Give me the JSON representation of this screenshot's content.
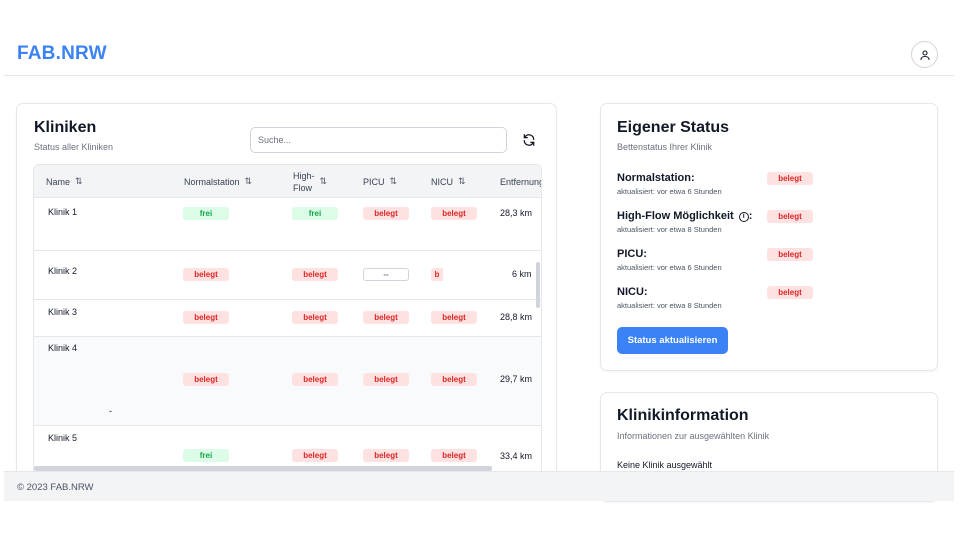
{
  "app": {
    "brand": "FAB.NRW"
  },
  "kliniken": {
    "title": "Kliniken",
    "subtitle": "Status aller Kliniken",
    "search_placeholder": "Suche...",
    "columns": {
      "name": "Name",
      "normal": "Normalstation",
      "highflow_1": "High-",
      "highflow_2": "Flow",
      "picu": "PICU",
      "nicu": "NICU",
      "distance": "Entfernung"
    },
    "rows": [
      {
        "name": "Klinik 1",
        "normal": "frei",
        "highflow": "frei",
        "picu": "belegt",
        "nicu": "belegt",
        "distance": "28,3 km"
      },
      {
        "name": "Klinik 2",
        "normal": "belegt",
        "highflow": "belegt",
        "picu": "--",
        "nicu": "b",
        "distance": "6 km"
      },
      {
        "name": "Klinik 3",
        "normal": "belegt",
        "highflow": "belegt",
        "picu": "belegt",
        "nicu": "belegt",
        "distance": "28,8 km"
      },
      {
        "name": "Klinik 4",
        "normal": "belegt",
        "highflow": "belegt",
        "picu": "belegt",
        "nicu": "belegt",
        "distance": "29,7 km",
        "extra": "-"
      },
      {
        "name": "Klinik 5",
        "normal": "frei",
        "highflow": "belegt",
        "picu": "belegt",
        "nicu": "belegt",
        "distance": "33,4 km"
      }
    ]
  },
  "status": {
    "title": "Eigener Status",
    "subtitle": "Bettenstatus Ihrer Klinik",
    "items": [
      {
        "label": "Normalstation:",
        "updated": "aktualisiert: vor etwa 6 Stunden",
        "value": "belegt"
      },
      {
        "label": "High-Flow Möglichkeit",
        "suffix": ":",
        "updated": "aktualisiert: vor etwa 8 Stunden",
        "value": "belegt"
      },
      {
        "label": "PICU:",
        "updated": "aktualisiert: vor etwa 6 Stunden",
        "value": "belegt"
      },
      {
        "label": "NICU:",
        "updated": "aktualisiert: vor etwa 8 Stunden",
        "value": "belegt"
      }
    ],
    "button": "Status aktualisieren"
  },
  "klinikinfo": {
    "title": "Klinikinformation",
    "subtitle": "Informationen zur ausgewählten Klinik",
    "empty": "Keine Klinik ausgewählt"
  },
  "footer": {
    "text": "© 2023 FAB.NRW"
  },
  "colors": {
    "accent": "#3b82f6",
    "frei_bg": "#dcfce7",
    "frei_fg": "#16a34a",
    "belegt_bg": "#fee2e2",
    "belegt_fg": "#dc2626"
  },
  "icons": {
    "user": "user-icon",
    "refresh": "refresh-icon",
    "sort": "sort-icon",
    "info": "info-icon"
  }
}
